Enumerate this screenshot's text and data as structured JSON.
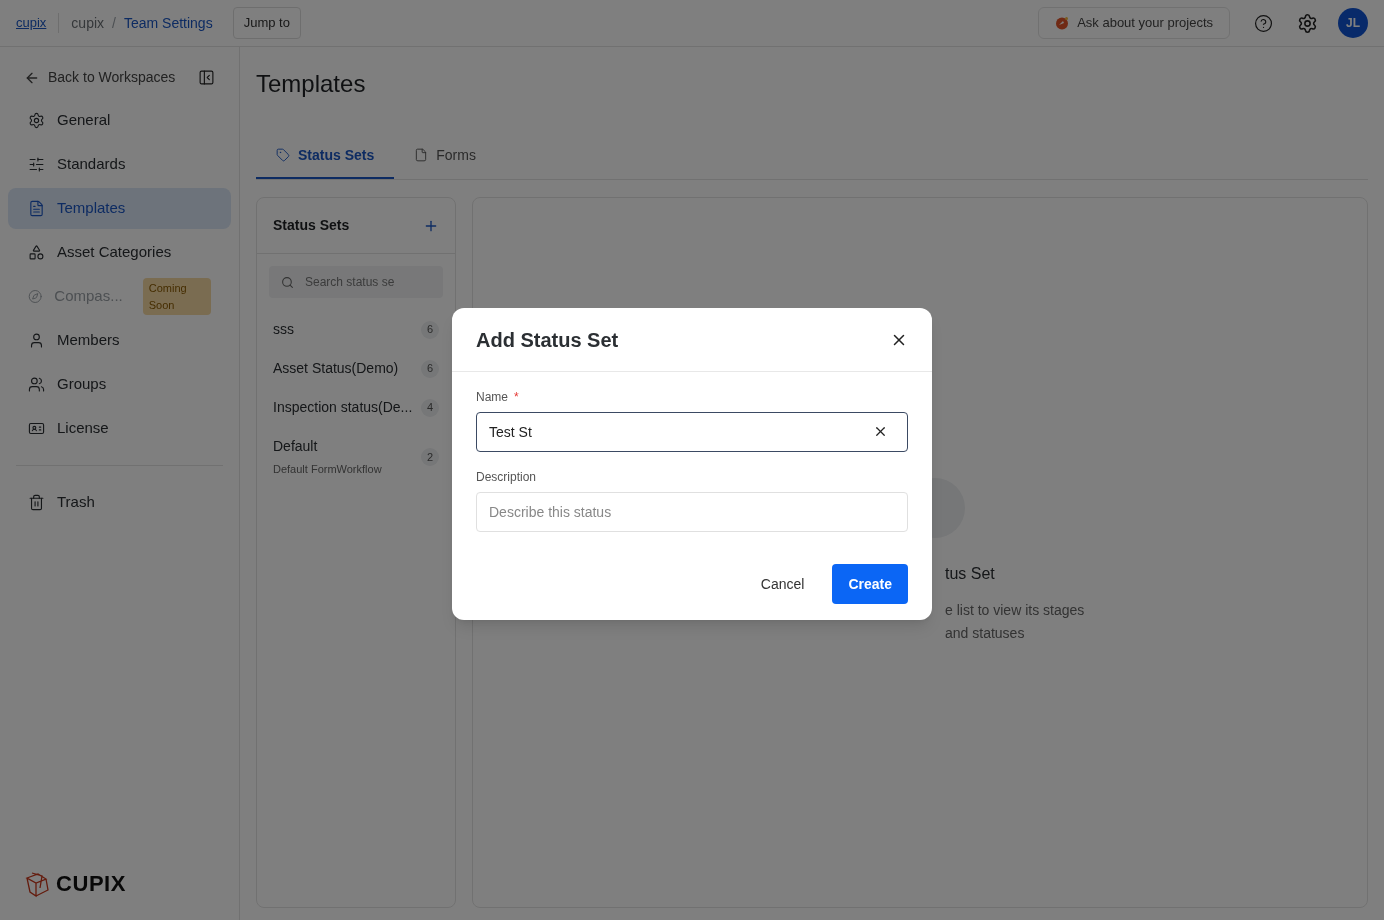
{
  "topbar": {
    "home_link": "cupix",
    "breadcrumb": [
      "cupix",
      "Team Settings"
    ],
    "breadcrumb_separator": "/",
    "jump_button": "Jump to",
    "ask_button": "Ask about your projects",
    "avatar": "JL"
  },
  "sidebar": {
    "back_link": "Back to Workspaces",
    "items": [
      {
        "label": "General",
        "selected": false,
        "disabled": false
      },
      {
        "label": "Standards",
        "selected": false,
        "disabled": false
      },
      {
        "label": "Templates",
        "selected": true,
        "disabled": false
      },
      {
        "label": "Asset Categories",
        "selected": false,
        "disabled": false
      },
      {
        "label": "Compas...",
        "selected": false,
        "disabled": true,
        "badge": "Coming Soon"
      },
      {
        "label": "Members",
        "selected": false,
        "disabled": false
      },
      {
        "label": "Groups",
        "selected": false,
        "disabled": false
      },
      {
        "label": "License",
        "selected": false,
        "disabled": false
      }
    ],
    "footer_items": [
      {
        "label": "Trash",
        "selected": false,
        "disabled": false
      }
    ],
    "logo": "CUPIX"
  },
  "page": {
    "title": "Templates",
    "tabs": [
      {
        "label": "Status Sets",
        "selected": true
      },
      {
        "label": "Forms",
        "selected": false
      }
    ],
    "list_panel": {
      "title": "Status Sets",
      "search_placeholder": "Search status se",
      "items": [
        {
          "name": "sss",
          "count": "6"
        },
        {
          "name": "Asset Status(Demo)",
          "count": "6"
        },
        {
          "name": "Inspection status(De...",
          "count": "4"
        },
        {
          "name": "Default",
          "description": "Default FormWorkflow",
          "count": "2"
        }
      ]
    },
    "empty_state": {
      "title": "tus Set",
      "lines": [
        "e list to view its stages",
        "and statuses"
      ]
    }
  },
  "dialog": {
    "title": "Add Status Set",
    "name_field": {
      "label": "Name",
      "required_mark": "*",
      "value": "Test St"
    },
    "description_field": {
      "label": "Description",
      "placeholder": "Describe this status"
    },
    "cancel_button": "Cancel",
    "create_button": "Create"
  }
}
